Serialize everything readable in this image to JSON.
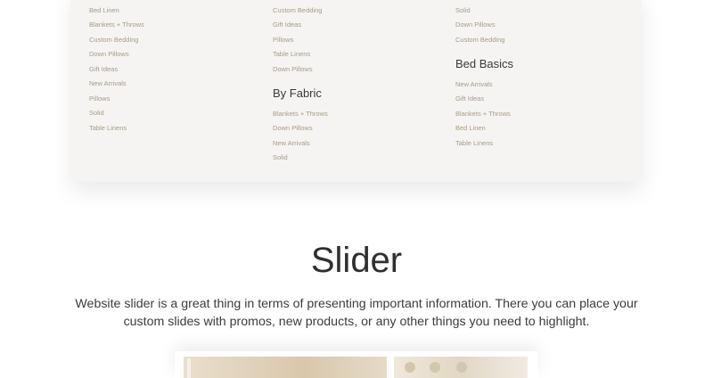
{
  "menu": {
    "col1": {
      "links": [
        "Bed Linen",
        "Blankets + Throws",
        "Custom Bedding",
        "Down Pillows",
        "Gift Ideas",
        "New Arrivals",
        "Pillows",
        "Solid",
        "Table Linens"
      ]
    },
    "col2": {
      "links_top": [
        "Custom Bedding",
        "Gift Ideas",
        "Pillows",
        "Table Linens",
        "Down Pillows"
      ],
      "heading": "By Fabric",
      "links_bottom": [
        "Blankets + Throws",
        "Down Pillows",
        "New Arrivals",
        "Solid"
      ]
    },
    "col3": {
      "links_top": [
        "Solid",
        "Down Pillows",
        "Custom Bedding"
      ],
      "heading": "Bed Basics",
      "links_bottom": [
        "New Arrivals",
        "Gift Ideas",
        "Blankets + Throws",
        "Bed Linen",
        "Table Linens"
      ]
    }
  },
  "slider_section": {
    "title": "Slider",
    "description": "Website slider is a great thing in terms of presenting important information. There you can place your custom slides with promos, new products, or any other things you need to highlight."
  },
  "colors": {
    "panel_bg": "#f5f4f3",
    "link": "#a89a84",
    "heading": "#3a3a3a"
  }
}
